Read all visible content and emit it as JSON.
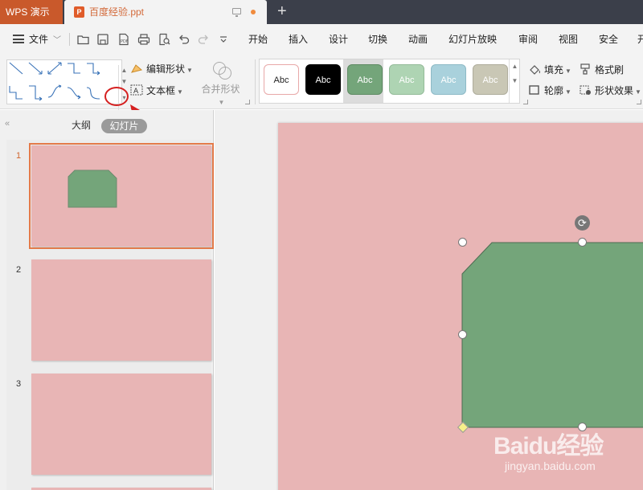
{
  "titlebar": {
    "app_name": "WPS 演示",
    "document_name": "百度经验.ppt",
    "doc_icon_letter": "P",
    "new_tab": "+"
  },
  "menubar": {
    "file_label": "文件",
    "tabs": [
      "开始",
      "插入",
      "设计",
      "切换",
      "动画",
      "幻灯片放映",
      "审阅",
      "视图",
      "安全",
      "开"
    ]
  },
  "ribbon": {
    "edit_shape": "编辑形状",
    "text_box": "文本框",
    "merge_shapes": "合并形状",
    "fill": "填充",
    "outline": "轮廓",
    "format_painter": "格式刷",
    "shape_effects": "形状效果",
    "style_label": "Abc",
    "styles": [
      {
        "label": "Abc",
        "bg": "#ffffff",
        "border": "#e8a8a8",
        "color": "#222222"
      },
      {
        "label": "Abc",
        "bg": "#000000",
        "border": "#000000",
        "color": "#ffffff"
      },
      {
        "label": "Abc",
        "bg": "#74a57a",
        "border": "#5e8a63",
        "color": "#ffffff"
      },
      {
        "label": "Abc",
        "bg": "#aed4b3",
        "border": "#94bb99",
        "color": "#ffffff"
      },
      {
        "label": "Abc",
        "bg": "#a9d1dc",
        "border": "#8dbac6",
        "color": "#ffffff"
      },
      {
        "label": "Abc",
        "bg": "#c9c7b5",
        "border": "#aeac9b",
        "color": "#ffffff"
      }
    ]
  },
  "left_panel": {
    "tab_outline": "大纲",
    "tab_slides": "幻灯片",
    "slides": [
      "1",
      "2",
      "3"
    ]
  },
  "colors": {
    "slide_bg": "#e8b5b5",
    "shape_fill": "#74a57a",
    "accent_orange": "#d0662f",
    "annotation_red": "#d52020"
  },
  "watermark": {
    "brand": "Baidu经验",
    "url": "jingyan.baidu.com"
  }
}
